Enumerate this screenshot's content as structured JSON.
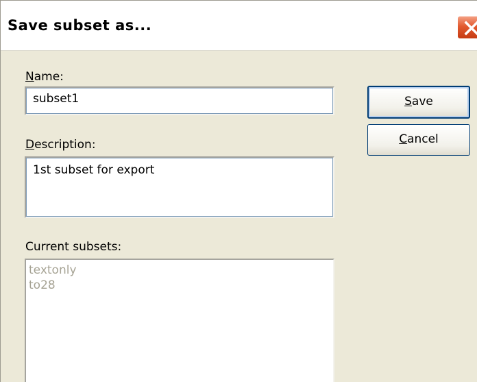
{
  "window": {
    "title": "Save subset as..."
  },
  "icons": {
    "close": "close-icon"
  },
  "name_field": {
    "label_mnemonic": "N",
    "label_rest": "ame:",
    "value": "subset1"
  },
  "description_field": {
    "label_mnemonic": "D",
    "label_rest": "escription:",
    "value": "1st subset for export"
  },
  "current_subsets": {
    "label": "Current subsets:",
    "items": [
      "textonly",
      "to28"
    ]
  },
  "buttons": {
    "save_mnemonic": "S",
    "save_rest": "ave",
    "cancel_mnemonic": "C",
    "cancel_rest": "ancel"
  },
  "colors": {
    "dialog_background": "#ece9d8",
    "close_button": "#e25a2f",
    "disabled_text": "#a6a394",
    "button_border": "#003c74"
  }
}
